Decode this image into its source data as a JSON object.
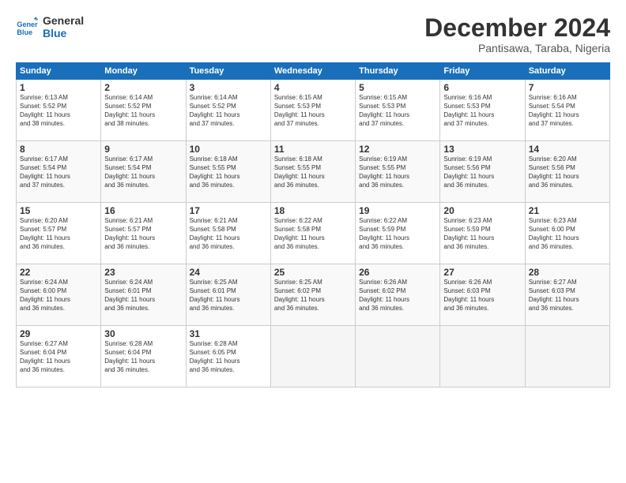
{
  "logo": {
    "line1": "General",
    "line2": "Blue"
  },
  "title": "December 2024",
  "location": "Pantisawa, Taraba, Nigeria",
  "days_of_week": [
    "Sunday",
    "Monday",
    "Tuesday",
    "Wednesday",
    "Thursday",
    "Friday",
    "Saturday"
  ],
  "weeks": [
    [
      {
        "day": "1",
        "info": "Sunrise: 6:13 AM\nSunset: 5:52 PM\nDaylight: 11 hours\nand 38 minutes."
      },
      {
        "day": "2",
        "info": "Sunrise: 6:14 AM\nSunset: 5:52 PM\nDaylight: 11 hours\nand 38 minutes."
      },
      {
        "day": "3",
        "info": "Sunrise: 6:14 AM\nSunset: 5:52 PM\nDaylight: 11 hours\nand 37 minutes."
      },
      {
        "day": "4",
        "info": "Sunrise: 6:15 AM\nSunset: 5:53 PM\nDaylight: 11 hours\nand 37 minutes."
      },
      {
        "day": "5",
        "info": "Sunrise: 6:15 AM\nSunset: 5:53 PM\nDaylight: 11 hours\nand 37 minutes."
      },
      {
        "day": "6",
        "info": "Sunrise: 6:16 AM\nSunset: 5:53 PM\nDaylight: 11 hours\nand 37 minutes."
      },
      {
        "day": "7",
        "info": "Sunrise: 6:16 AM\nSunset: 5:54 PM\nDaylight: 11 hours\nand 37 minutes."
      }
    ],
    [
      {
        "day": "8",
        "info": "Sunrise: 6:17 AM\nSunset: 5:54 PM\nDaylight: 11 hours\nand 37 minutes."
      },
      {
        "day": "9",
        "info": "Sunrise: 6:17 AM\nSunset: 5:54 PM\nDaylight: 11 hours\nand 36 minutes."
      },
      {
        "day": "10",
        "info": "Sunrise: 6:18 AM\nSunset: 5:55 PM\nDaylight: 11 hours\nand 36 minutes."
      },
      {
        "day": "11",
        "info": "Sunrise: 6:18 AM\nSunset: 5:55 PM\nDaylight: 11 hours\nand 36 minutes."
      },
      {
        "day": "12",
        "info": "Sunrise: 6:19 AM\nSunset: 5:55 PM\nDaylight: 11 hours\nand 36 minutes."
      },
      {
        "day": "13",
        "info": "Sunrise: 6:19 AM\nSunset: 5:56 PM\nDaylight: 11 hours\nand 36 minutes."
      },
      {
        "day": "14",
        "info": "Sunrise: 6:20 AM\nSunset: 5:56 PM\nDaylight: 11 hours\nand 36 minutes."
      }
    ],
    [
      {
        "day": "15",
        "info": "Sunrise: 6:20 AM\nSunset: 5:57 PM\nDaylight: 11 hours\nand 36 minutes."
      },
      {
        "day": "16",
        "info": "Sunrise: 6:21 AM\nSunset: 5:57 PM\nDaylight: 11 hours\nand 36 minutes."
      },
      {
        "day": "17",
        "info": "Sunrise: 6:21 AM\nSunset: 5:58 PM\nDaylight: 11 hours\nand 36 minutes."
      },
      {
        "day": "18",
        "info": "Sunrise: 6:22 AM\nSunset: 5:58 PM\nDaylight: 11 hours\nand 36 minutes."
      },
      {
        "day": "19",
        "info": "Sunrise: 6:22 AM\nSunset: 5:59 PM\nDaylight: 11 hours\nand 36 minutes."
      },
      {
        "day": "20",
        "info": "Sunrise: 6:23 AM\nSunset: 5:59 PM\nDaylight: 11 hours\nand 36 minutes."
      },
      {
        "day": "21",
        "info": "Sunrise: 6:23 AM\nSunset: 6:00 PM\nDaylight: 11 hours\nand 36 minutes."
      }
    ],
    [
      {
        "day": "22",
        "info": "Sunrise: 6:24 AM\nSunset: 6:00 PM\nDaylight: 11 hours\nand 36 minutes."
      },
      {
        "day": "23",
        "info": "Sunrise: 6:24 AM\nSunset: 6:01 PM\nDaylight: 11 hours\nand 36 minutes."
      },
      {
        "day": "24",
        "info": "Sunrise: 6:25 AM\nSunset: 6:01 PM\nDaylight: 11 hours\nand 36 minutes."
      },
      {
        "day": "25",
        "info": "Sunrise: 6:25 AM\nSunset: 6:02 PM\nDaylight: 11 hours\nand 36 minutes."
      },
      {
        "day": "26",
        "info": "Sunrise: 6:26 AM\nSunset: 6:02 PM\nDaylight: 11 hours\nand 36 minutes."
      },
      {
        "day": "27",
        "info": "Sunrise: 6:26 AM\nSunset: 6:03 PM\nDaylight: 11 hours\nand 36 minutes."
      },
      {
        "day": "28",
        "info": "Sunrise: 6:27 AM\nSunset: 6:03 PM\nDaylight: 11 hours\nand 36 minutes."
      }
    ],
    [
      {
        "day": "29",
        "info": "Sunrise: 6:27 AM\nSunset: 6:04 PM\nDaylight: 11 hours\nand 36 minutes."
      },
      {
        "day": "30",
        "info": "Sunrise: 6:28 AM\nSunset: 6:04 PM\nDaylight: 11 hours\nand 36 minutes."
      },
      {
        "day": "31",
        "info": "Sunrise: 6:28 AM\nSunset: 6:05 PM\nDaylight: 11 hours\nand 36 minutes."
      },
      {
        "day": "",
        "info": ""
      },
      {
        "day": "",
        "info": ""
      },
      {
        "day": "",
        "info": ""
      },
      {
        "day": "",
        "info": ""
      }
    ]
  ]
}
